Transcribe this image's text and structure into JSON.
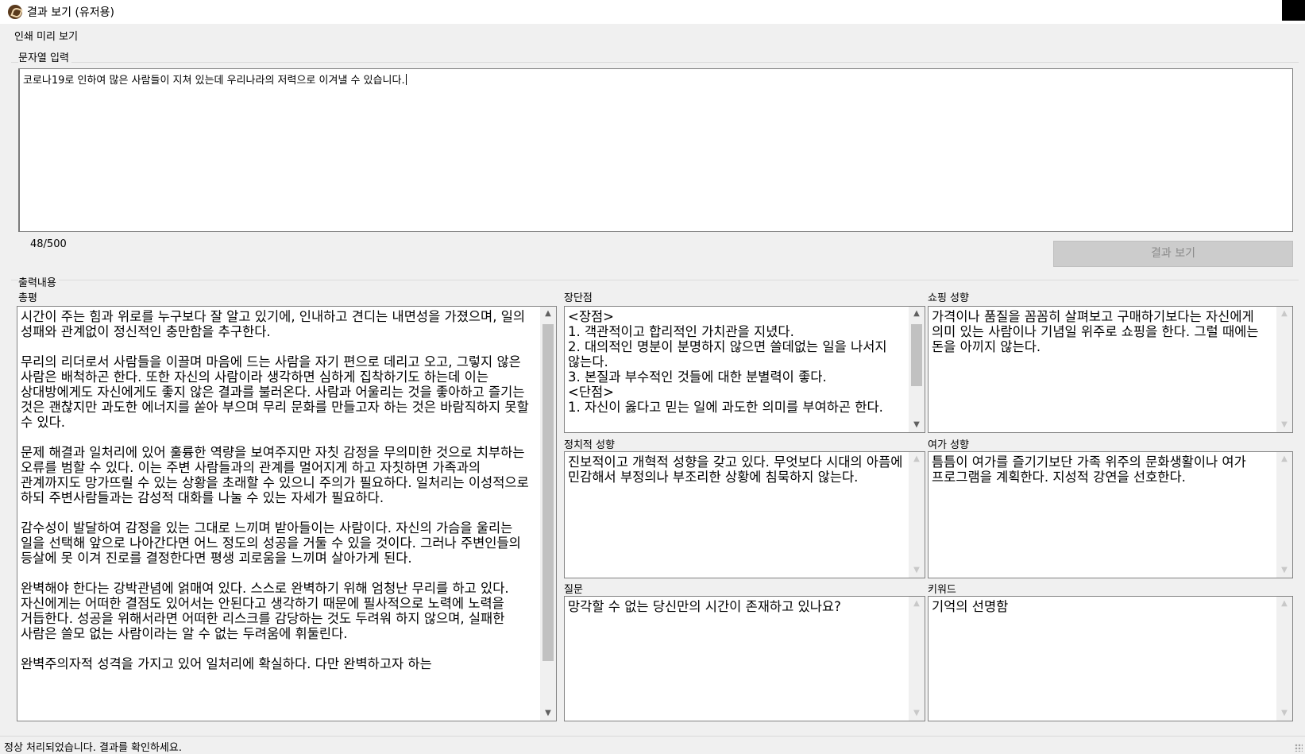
{
  "window": {
    "title": "결과 보기 (유저용)"
  },
  "menu": {
    "print_preview": "인쇄 미리 보기"
  },
  "input_section": {
    "label": "문자열 입력",
    "value": "코로나19로 인하여 많은 사람들이 지쳐 있는데 우리나라의 저력으로 이겨낼 수 있습니다.",
    "counter": "48/500",
    "result_button": "결과 보기"
  },
  "output_section": {
    "label": "출력내용",
    "summary": {
      "label": "총평",
      "text": "시간이 주는 힘과 위로를 누구보다 잘 알고 있기에, 인내하고 견디는 내면성을 가졌으며, 일의 성패와 관계없이 정신적인 충만함을 추구한다.\n\n무리의 리더로서 사람들을 이끌며 마음에 드는 사람을 자기 편으로 데리고 오고, 그렇지 않은 사람은 배척하곤 한다. 또한 자신의 사람이라 생각하면 심하게 집착하기도 하는데 이는 상대방에게도 자신에게도 좋지 않은 결과를 불러온다. 사람과 어울리는 것을 좋아하고 즐기는 것은 괜찮지만 과도한 에너지를 쏟아 부으며 무리 문화를 만들고자 하는 것은 바람직하지 못할 수 있다.\n\n문제 해결과 일처리에 있어 훌륭한 역량을 보여주지만 자칫 감정을 무의미한 것으로 치부하는 오류를 범할 수 있다. 이는 주변 사람들과의 관계를 멀어지게 하고 자칫하면 가족과의 관계까지도 망가뜨릴 수 있는 상황을 초래할 수 있으니 주의가 필요하다. 일처리는 이성적으로 하되 주변사람들과는 감성적 대화를 나눌 수 있는 자세가 필요하다.\n\n감수성이 발달하여 감정을 있는 그대로 느끼며 받아들이는 사람이다. 자신의 가슴을 울리는 일을 선택해 앞으로 나아간다면 어느 정도의 성공을 거둘 수 있을 것이다. 그러나 주변인들의 등살에 못 이겨 진로를 결정한다면 평생 괴로움을 느끼며 살아가게 된다.\n\n완벽해야 한다는 강박관념에 얽매여 있다. 스스로 완벽하기 위해 엄청난 무리를 하고 있다. 자신에게는 어떠한 결점도 있어서는 안된다고 생각하기 때문에 필사적으로 노력에 노력을 거듭한다. 성공을 위해서라면 어떠한 리스크를 감당하는 것도 두려워 하지 않으며, 실패한 사람은 쓸모 없는 사람이라는 알 수 없는 두려움에 휘둘린다.\n\n완벽주의자적 성격을 가지고 있어 일처리에 확실하다. 다만 완벽하고자 하는"
    },
    "pros_cons": {
      "label": "장단점",
      "text": "<장점>\n1. 객관적이고 합리적인 가치관을 지녔다.\n2. 대의적인 명분이 분명하지 않으면 쓸데없는 일을 나서지 않는다.\n3. 본질과 부수적인 것들에 대한 분별력이 좋다.\n<단점>\n1. 자신이 옳다고 믿는 일에 과도한 의미를 부여하곤 한다."
    },
    "shopping": {
      "label": "쇼핑 성향",
      "text": "가격이나 품질을 꼼꼼히 살펴보고 구매하기보다는 자신에게 의미 있는 사람이나 기념일 위주로 쇼핑을 한다. 그럴 때에는 돈을 아끼지 않는다."
    },
    "political": {
      "label": "정치적 성향",
      "text": "진보적이고 개혁적 성향을 갖고 있다. 무엇보다 시대의 아픔에 민감해서 부정의나 부조리한 상황에 침묵하지 않는다."
    },
    "leisure": {
      "label": "여가 성향",
      "text": "틈틈이 여가를 즐기기보단 가족 위주의 문화생활이나 여가 프로그램을 계획한다. 지성적 강연을 선호한다."
    },
    "question": {
      "label": "질문",
      "text": "망각할 수 없는 당신만의 시간이 존재하고 있나요?"
    },
    "keyword": {
      "label": "키워드",
      "text": "기억의 선명함"
    }
  },
  "status": {
    "text": "정상 처리되었습니다. 결과를 확인하세요."
  }
}
